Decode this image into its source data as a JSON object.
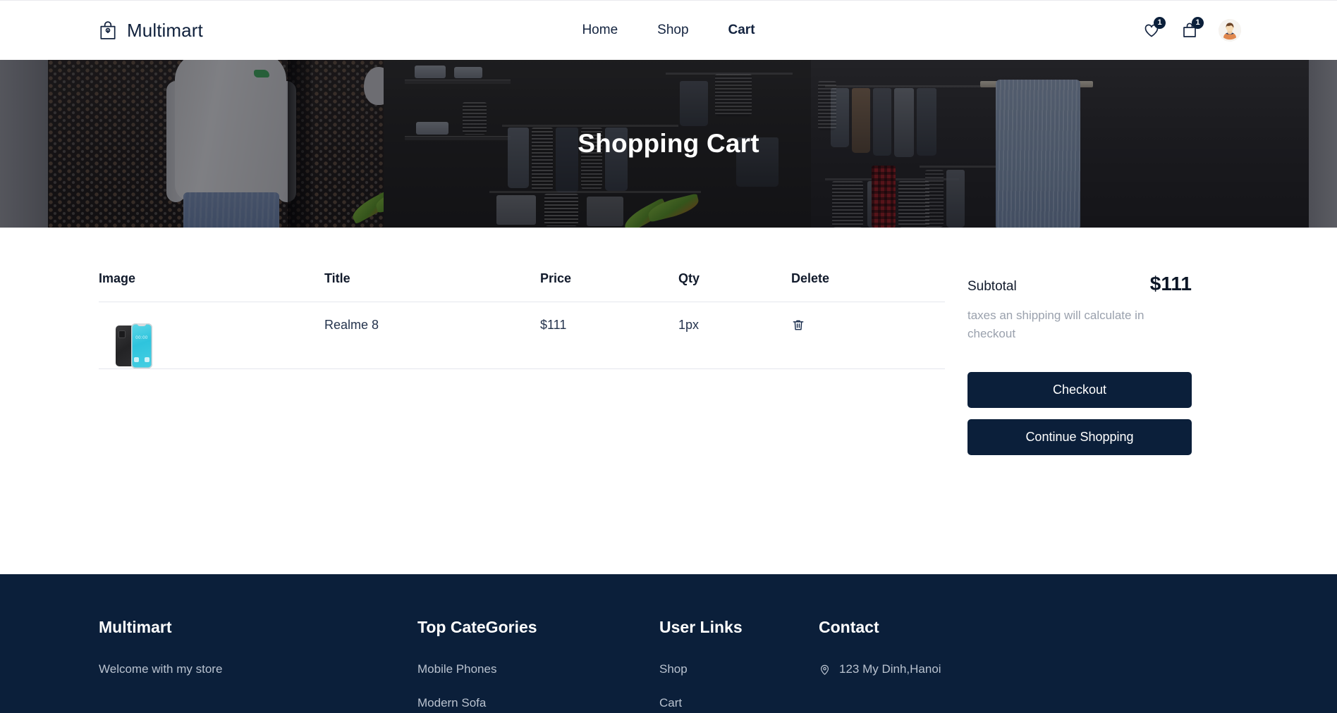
{
  "header": {
    "brand": {
      "name": "Multimart",
      "icon": "shopping-bag-icon"
    },
    "nav": [
      {
        "label": "Home",
        "active": false
      },
      {
        "label": "Shop",
        "active": false
      },
      {
        "label": "Cart",
        "active": true
      }
    ],
    "wishlist": {
      "icon": "heart-icon",
      "count": "1"
    },
    "cart": {
      "icon": "bag-icon",
      "count": "1"
    },
    "avatar": {
      "icon": "user-avatar"
    }
  },
  "hero": {
    "title": "Shopping Cart"
  },
  "cart": {
    "columns": [
      "Image",
      "Title",
      "Price",
      "Qty",
      "Delete"
    ],
    "rows": [
      {
        "image": "realme-8-thumbnail",
        "title": "Realme 8",
        "price": "$111",
        "qty": "1px",
        "delete_icon": "trash-icon"
      }
    ]
  },
  "summary": {
    "label": "Subtotal",
    "amount": "$111",
    "note": "taxes an shipping will calculate in checkout",
    "checkout_label": "Checkout",
    "continue_label": "Continue Shopping"
  },
  "footer": {
    "brand": {
      "title": "Multimart",
      "tagline": "Welcome with my store"
    },
    "categories": {
      "title": "Top CateGories",
      "items": [
        "Mobile Phones",
        "Modern Sofa"
      ]
    },
    "user_links": {
      "title": "User Links",
      "items": [
        "Shop",
        "Cart"
      ]
    },
    "contact": {
      "title": "Contact",
      "address": "123 My Dinh,Hanoi",
      "address_icon": "map-pin-icon"
    }
  },
  "colors": {
    "navy": "#0b1f3a",
    "text_dark": "#111a2b",
    "muted": "#9aa1ad",
    "footer_text": "#b9c2cf"
  }
}
